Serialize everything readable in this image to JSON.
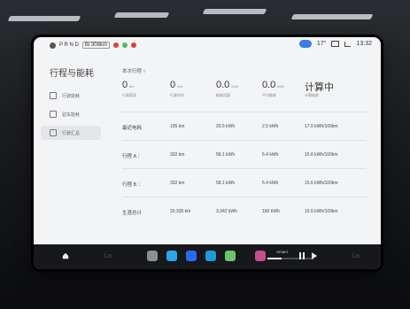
{
  "status": {
    "user_icon": "person-icon",
    "gear": "P R N D",
    "badge": "Bi 308km",
    "temperature": "17°",
    "clock": "13:32"
  },
  "sidebar": {
    "title": "行程与能耗",
    "items": [
      {
        "label": "行驶能耗",
        "icon": "gauge-icon"
      },
      {
        "label": "驻车能耗",
        "icon": "parking-icon"
      },
      {
        "label": "行驶汇总",
        "icon": "chart-icon"
      }
    ]
  },
  "main": {
    "section_title": "本次行程 ○",
    "summary": [
      {
        "value": "0",
        "unit": "km",
        "label": "行驶距离"
      },
      {
        "value": "0",
        "unit": "min",
        "label": "行驶时间"
      },
      {
        "value": "0.0",
        "unit": "kWh",
        "label": "能耗用量"
      },
      {
        "value": "0.0",
        "unit": "kWh",
        "label": "平均能耗"
      },
      {
        "value": "计算中",
        "unit": "",
        "label": "计算能耗"
      }
    ],
    "rows": [
      {
        "label": "最近电耗",
        "cells": [
          "105 km",
          "20.5 kWh",
          "2.5 kWh",
          "17.0 kWh/100km"
        ]
      },
      {
        "label": "行程 A ：",
        "cells": [
          "332 km",
          "58.1 kWh",
          "5.4 kWh",
          "15.6 kWh/100km"
        ]
      },
      {
        "label": "行程 B ：",
        "cells": [
          "332 km",
          "58.1 kWh",
          "5.4 kWh",
          "15.6 kWh/100km"
        ]
      },
      {
        "label": "生涯总计",
        "cells": [
          "20,335 km",
          "3,342 kWh",
          "160 kWh",
          "15.6 kWh/100km"
        ]
      }
    ]
  },
  "dock": {
    "left_text": "Lo",
    "right_text": "Lo",
    "media_title": "Amani",
    "media_progress": 0.3,
    "apps": [
      "camera-icon",
      "phone-icon",
      "zoom-icon",
      "map-icon",
      "grid-icon",
      "music-icon"
    ],
    "app_colors": [
      "#8a8f96",
      "#2ea5e6",
      "#2a6af0",
      "#1e9ad6",
      "#6bc46d",
      "#c2508a"
    ]
  }
}
